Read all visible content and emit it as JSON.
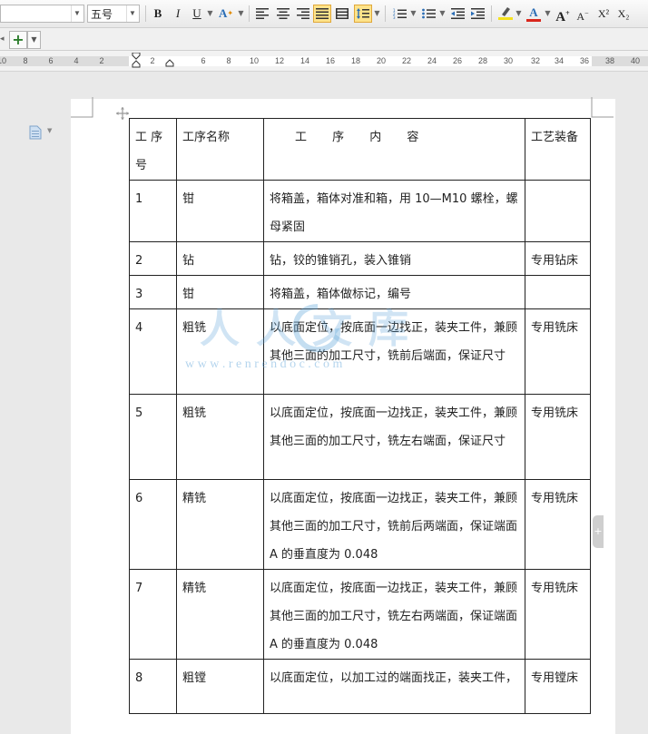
{
  "toolbar": {
    "font_size_value": "五号",
    "bold_label": "B",
    "italic_label": "I",
    "underline_label": "U",
    "grow_font_label": "A",
    "shrink_font_label": "A",
    "font_color_label": "A",
    "superscript_label": "X²",
    "subscript_label": "X₂",
    "highlight_color": "#f5e11e",
    "font_color": "#d9261c",
    "accent_icon_color": "#2a6db5"
  },
  "tabbar": {
    "add_label": "+"
  },
  "ruler": {
    "numbers": [
      "10",
      "8",
      "6",
      "4",
      "2",
      "2",
      "6",
      "8",
      "10",
      "12",
      "14",
      "16",
      "18",
      "20",
      "22",
      "24",
      "26",
      "28",
      "30",
      "32",
      "34",
      "36",
      "38",
      "40"
    ]
  },
  "table": {
    "header": [
      "工 序\n号",
      "工序名称",
      "工 序 内 容",
      "工艺装备"
    ],
    "rows": [
      {
        "no": "1",
        "name": "钳",
        "content": "将箱盖，箱体对准和箱，用 10—M10 螺栓，螺母紧固",
        "equip": ""
      },
      {
        "no": "2",
        "name": "钻",
        "content": "钻，铰的锥销孔，装入锥销",
        "equip": "专用钻床"
      },
      {
        "no": "3",
        "name": "钳",
        "content": "将箱盖，箱体做标记，编号",
        "equip": ""
      },
      {
        "no": "4",
        "name": "粗铣",
        "content": "以底面定位，按底面一边找正，装夹工件，兼顾其他三面的加工尺寸，铣前后端面，保证尺寸",
        "equip": "专用铣床"
      },
      {
        "no": "5",
        "name": "粗铣",
        "content": "以底面定位，按底面一边找正，装夹工件，兼顾其他三面的加工尺寸，铣左右端面，保证尺寸",
        "equip": "专用铣床"
      },
      {
        "no": "6",
        "name": "精铣",
        "content": "以底面定位，按底面一边找正，装夹工件，兼顾其他三面的加工尺寸，铣前后两端面，保证端面 A 的垂直度为 0.048",
        "equip": "专用铣床"
      },
      {
        "no": "7",
        "name": "精铣",
        "content": "以底面定位，按底面一边找正，装夹工件，兼顾其他三面的加工尺寸，铣左右两端面，保证端面 A 的垂直度为 0.048",
        "equip": "专用铣床"
      },
      {
        "no": "8",
        "name": "粗镗",
        "content": "以底面定位，以加工过的端面找正，装夹工件，",
        "equip": "专用镗床"
      }
    ]
  },
  "watermark": {
    "text": "人人文库",
    "url_text": "w w w . r e n r e n d o c . c o m"
  }
}
